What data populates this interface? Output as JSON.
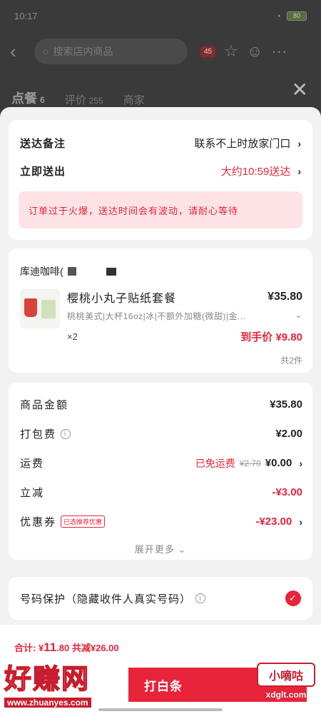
{
  "status": {
    "time": "10:17",
    "battery": "80"
  },
  "nav": {
    "search_placeholder": "搜索店内商品",
    "badge": "45"
  },
  "shop_tabs": [
    {
      "label": "点餐",
      "count": "6"
    },
    {
      "label": "评价",
      "count": "255"
    },
    {
      "label": "商家",
      "count": ""
    }
  ],
  "delivery": {
    "note_label": "送达备注",
    "note_value": "联系不上时放家门口",
    "time_label": "立即送出",
    "time_value": "大约10:59送达",
    "notice": "订单过于火爆，送达时间会有波动，请耐心等待"
  },
  "order": {
    "shop_name": "库迪咖啡(",
    "item_name": "樱桃小丸子贴纸套餐",
    "item_price": "¥35.80",
    "item_spec": "桃桃美式|大杯16oz|冰|不额外加糖(微甜)|金...",
    "qty": "×2",
    "deal_price": "到手价 ¥9.80",
    "total_count": "共2件"
  },
  "fees": {
    "goods_label": "商品金额",
    "goods_value": "¥35.80",
    "packing_label": "打包费",
    "packing_value": "¥2.00",
    "shipping_label": "运费",
    "shipping_free": "已免运费",
    "shipping_orig": "¥2.70",
    "shipping_value": "¥0.00",
    "discount_label": "立减",
    "discount_value": "-¥3.00",
    "coupon_label": "优惠券",
    "coupon_tag": "已选推荐优惠",
    "coupon_value": "-¥23.00",
    "expand": "展开更多"
  },
  "privacy": {
    "label": "号码保护（隐藏收件人真实号码）"
  },
  "bottom": {
    "total_label": "合计: ¥",
    "total_int": "11",
    "total_dec": ".80",
    "saved": "共减¥26.00",
    "pay_button": "打白条"
  },
  "watermarks": {
    "left_text": "好赚网",
    "left_url": "www.zhuanyes.com",
    "right_text": "小嘀咕",
    "right_url": "xdglt.com"
  },
  "colors": {
    "accent": "#e8243a",
    "notice_bg": "#fde3e6",
    "sheet_bg": "#f2f2f2"
  }
}
